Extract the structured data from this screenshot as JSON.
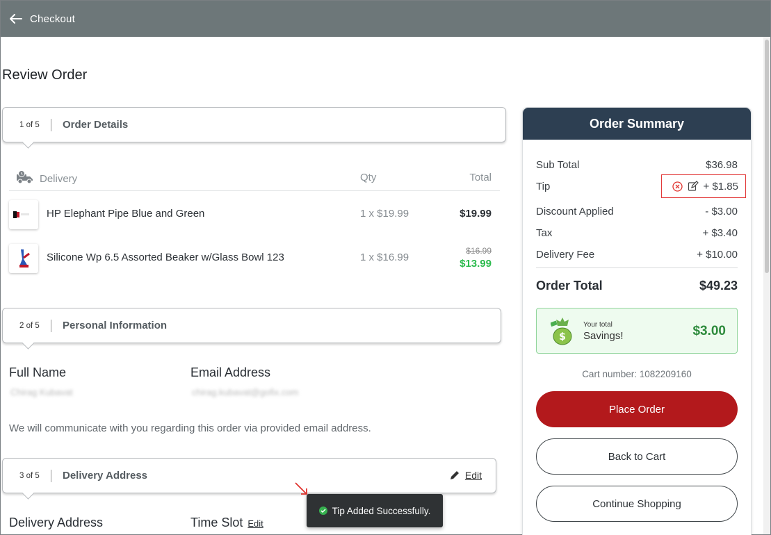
{
  "header": {
    "title": "Checkout"
  },
  "page": {
    "title": "Review Order"
  },
  "steps": [
    {
      "num": "1 of 5",
      "label": "Order Details"
    },
    {
      "num": "2 of 5",
      "label": "Personal Information"
    },
    {
      "num": "3 of 5",
      "label": "Delivery Address",
      "edit_label": "Edit"
    }
  ],
  "items_table": {
    "header": {
      "delivery": "Delivery",
      "qty": "Qty",
      "total": "Total"
    },
    "rows": [
      {
        "name": "HP Elephant Pipe Blue and Green",
        "qty": "1 x $19.99",
        "total": "$19.99"
      },
      {
        "name": "Silicone Wp 6.5 Assorted Beaker w/Glass Bowl 123",
        "qty": "1 x $16.99",
        "old_total": "$16.99",
        "total": "$13.99"
      }
    ]
  },
  "personal": {
    "full_name_label": "Full Name",
    "full_name_value": "Chirag Kubavat",
    "email_label": "Email Address",
    "email_value": "chirag.kubavat@gofix.com",
    "note": "We will communicate with you regarding this order via provided email address."
  },
  "delivery": {
    "address_label": "Delivery Address",
    "time_slot_label": "Time Slot",
    "time_slot_edit": "Edit"
  },
  "toast": {
    "message": "Tip Added Successfully."
  },
  "summary": {
    "title": "Order Summary",
    "sub_total_label": "Sub Total",
    "sub_total": "$36.98",
    "tip_label": "Tip",
    "tip": "+ $1.85",
    "discount_label": "Discount Applied",
    "discount": "- $3.00",
    "tax_label": "Tax",
    "tax": "+ $3.40",
    "delivery_fee_label": "Delivery Fee",
    "delivery_fee": "+ $10.00",
    "order_total_label": "Order Total",
    "order_total": "$49.23",
    "savings_sub": "Your total",
    "savings_label": "Savings!",
    "savings": "$3.00",
    "cart_number": "Cart number: 1082209160",
    "place_order": "Place Order",
    "back_to_cart": "Back to Cart",
    "continue_shopping": "Continue Shopping"
  },
  "colors": {
    "header_bg": "#6d7779",
    "summary_header": "#2d3f52",
    "primary_button": "#b3191c",
    "discount_green": "#2dbb4e",
    "savings_green": "#2e8b3d",
    "highlight_red": "#e23a3a"
  }
}
